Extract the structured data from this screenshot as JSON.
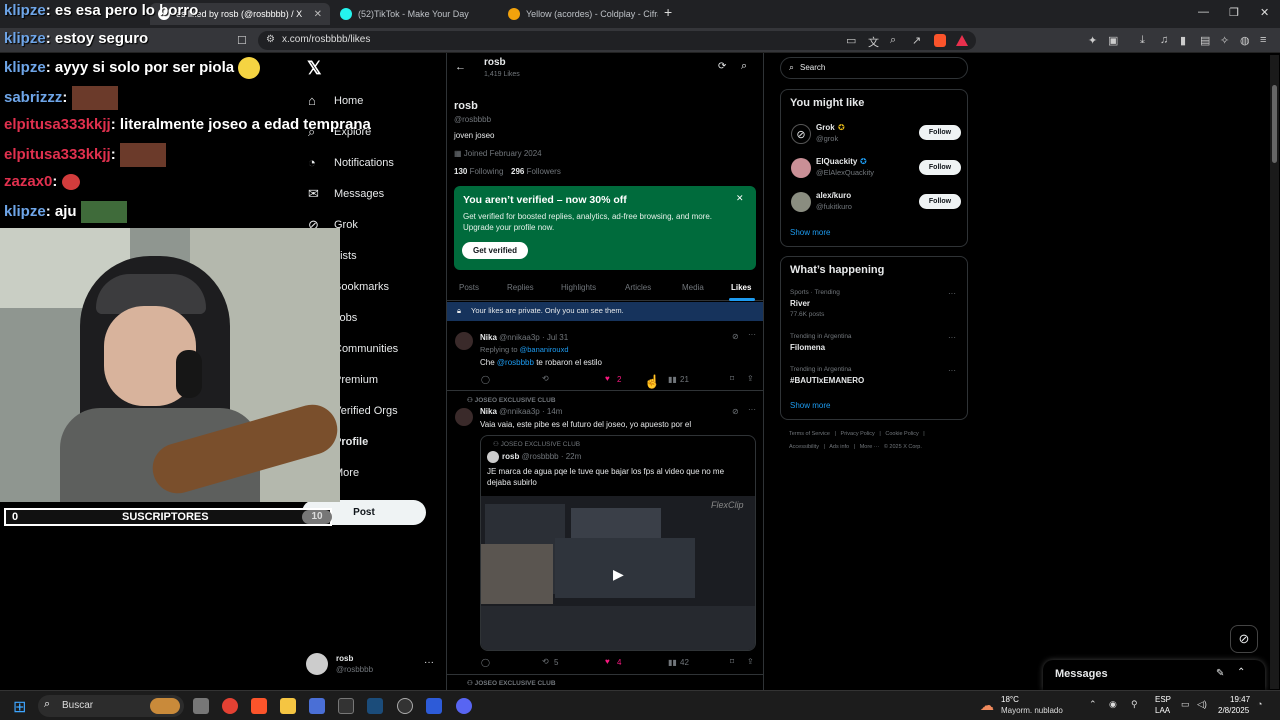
{
  "browser": {
    "tabs": [
      {
        "label": "es liked by rosb (@rosbbbb) / X",
        "active": true
      },
      {
        "label": "(52)TikTok - Make Your Day",
        "active": false
      },
      {
        "label": "Yellow (acordes) - Coldplay - Cifra Cl",
        "active": false
      }
    ],
    "new_tab": "+",
    "url": "x.com/rosbbbb/likes"
  },
  "overlay": {
    "chat": [
      {
        "user": "klipze",
        "text": ": es esa pero lo borro"
      },
      {
        "user": "klipze",
        "text": ": estoy seguro"
      },
      {
        "user": "klipze",
        "text": ": ayyy si solo por ser piola"
      },
      {
        "user": "sabrizzz",
        "text": ":"
      },
      {
        "user": "elpitusa333kkjj",
        "text": ": literalmente joseo a edad temprana"
      },
      {
        "user": "elpitusa333kkjj",
        "text": ":"
      },
      {
        "user": "zazax0",
        "text": ":"
      },
      {
        "user": "klipze",
        "text": ": aju"
      }
    ],
    "subs_count": "0",
    "subs_label": "SUSCRIPTORES",
    "subs_goal": "10"
  },
  "nav": {
    "items": [
      "Home",
      "Explore",
      "Notifications",
      "Messages",
      "Grok",
      "Lists",
      "Bookmarks",
      "Jobs",
      "Communities",
      "Premium",
      "Verified Orgs",
      "Profile",
      "More"
    ],
    "post_label": "Post",
    "account_name": "rosb",
    "account_handle": "@rosbbbb"
  },
  "profile": {
    "header_name": "rosb",
    "header_count": "1,419 Likes",
    "name": "rosb",
    "handle": "@rosbbbb",
    "bio": "joven joseo",
    "joined": "Joined February 2024",
    "following_count": "130",
    "following_label": "Following",
    "followers_count": "296",
    "followers_label": "Followers"
  },
  "promo": {
    "title": "You aren’t verified – now 30% off",
    "body": "Get verified for boosted replies, analytics, ad-free browsing, and more. Upgrade your profile now.",
    "button": "Get verified",
    "color": "#006b3c"
  },
  "tabs": [
    "Posts",
    "Replies",
    "Highlights",
    "Articles",
    "Media",
    "Likes"
  ],
  "private_notice": "Your likes are private. Only you can see them.",
  "tweets": [
    {
      "name": "Nika",
      "handle": "@nnikaa3p",
      "time": "· Jul 31",
      "replying_prefix": "Replying to",
      "replying_to": "@bananirouxd",
      "text_pre": "Che",
      "mention": "@rosbbbb",
      "text_post": "te robaron el estilo",
      "likes": "2",
      "views": "21"
    },
    {
      "social": "JOSEO EXCLUSIVE CLUB",
      "name": "Nika",
      "handle": "@nnikaa3p",
      "time": "· 14m",
      "text": "Vaia vaia, este pibe es el futuro del joseo,  yo apuesto por el",
      "quote": {
        "social": "JOSEO EXCLUSIVE CLUB",
        "name": "rosb",
        "handle": "@rosbbbb",
        "time": "· 22m",
        "text": "JE marca de agua pqe le tuve que bajar los fps al video que no me dejaba subirlo",
        "watermark": "FlexClip"
      },
      "retweets": "5",
      "likes": "4",
      "views": "42"
    }
  ],
  "next_social": "JOSEO EXCLUSIVE CLUB",
  "right": {
    "search_placeholder": "Search",
    "might_like_title": "You might like",
    "suggestions": [
      {
        "name": "Grok",
        "handle": "@grok",
        "button": "Follow"
      },
      {
        "name": "ElQuackity",
        "handle": "@ElAlexQuackity",
        "button": "Follow"
      },
      {
        "name": "alex/kuro",
        "handle": "@fukitkuro",
        "button": "Follow"
      }
    ],
    "show_more": "Show more",
    "happening_title": "What’s happening",
    "trends": [
      {
        "context": "Sports · Trending",
        "name": "River",
        "posts": "77.6K posts"
      },
      {
        "context": "Trending in Argentina",
        "name": "Filomena",
        "posts": ""
      },
      {
        "context": "Trending in Argentina",
        "name": "#BAUTIxEMANERO",
        "posts": ""
      }
    ],
    "show_more_2": "Show more",
    "footer_line1": "Terms of Service   |   Privacy Policy   |   Cookie Policy   |",
    "footer_line2": "Accessibility   |   Ads info   |   More ···   © 2025 X Corp.",
    "messages": "Messages"
  },
  "taskbar": {
    "search": "Buscar",
    "weather_temp": "18°C",
    "weather_desc": "Mayorm. nublado",
    "lang1": "ESP",
    "lang2": "LAA",
    "time": "19:47",
    "date": "2/8/2025"
  }
}
